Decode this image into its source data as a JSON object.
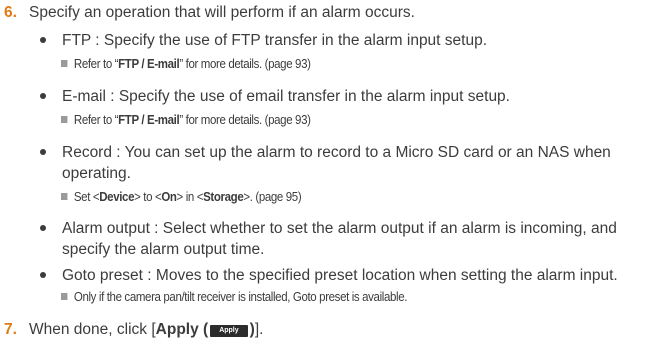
{
  "step6": {
    "num": "6.",
    "text": "Specify an operation that will perform if an alarm occurs."
  },
  "bullets": [
    {
      "text": "FTP : Specify the use of FTP transfer in the alarm input setup."
    },
    {
      "text": "E-mail : Specify the use of email transfer in the alarm input setup."
    },
    {
      "text": "Record : You can set up the alarm to record to a Micro SD card or an NAS when operating."
    },
    {
      "text": "Alarm output : Select whether to set the alarm output if an alarm is incoming, and specify the alarm output time."
    },
    {
      "text": "Goto preset : Moves to the specified preset location when setting the alarm input."
    }
  ],
  "notes": {
    "ftp": {
      "pre": "Refer to “",
      "bold": "FTP / E-mail",
      "post": "” for more details. (page 93)"
    },
    "email": {
      "pre": "Refer to “",
      "bold": "FTP / E-mail",
      "post": "” for more details. (page 93)"
    },
    "record": {
      "p1": "Set <",
      "b1": "Device",
      "p2": "> to <",
      "b2": "On",
      "p3": "> in <",
      "b3": "Storage",
      "p4": ">. (page 95)"
    },
    "goto": {
      "text": "Only if the camera pan/tilt receiver is installed, Goto preset is available."
    }
  },
  "step7": {
    "num": "7.",
    "pre": "When done, click [",
    "bold": "Apply (",
    "button": "Apply",
    "close": ")",
    "post": "]."
  }
}
